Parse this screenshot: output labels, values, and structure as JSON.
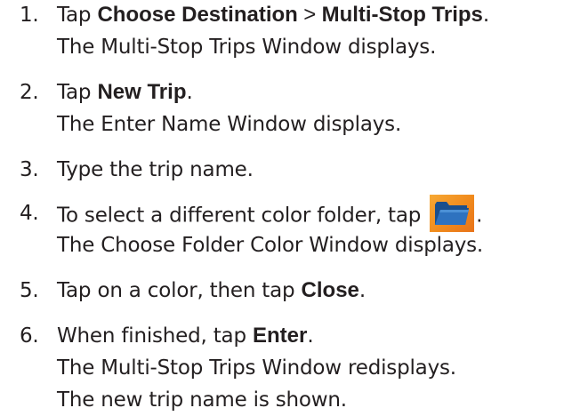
{
  "steps": [
    {
      "number": "1.",
      "line1": {
        "prefix": "Tap ",
        "bold1": "Choose Destination",
        "separator": " > ",
        "bold2": "Multi-Stop Trips",
        "suffix": "."
      },
      "line2": "The Multi-Stop Trips Window displays."
    },
    {
      "number": "2.",
      "line1": {
        "prefix": "Tap ",
        "bold": "New Trip",
        "suffix": "."
      },
      "line2": "The Enter Name Window displays."
    },
    {
      "number": "3.",
      "line1": "Type the trip name."
    },
    {
      "number": "4.",
      "line1": {
        "prefix": "To select a different color folder, tap",
        "suffix": "."
      },
      "line2": "The Choose Folder Color Window displays.",
      "icon": "blue-folder-icon"
    },
    {
      "number": "5.",
      "line1": {
        "prefix": "Tap on a color, then tap ",
        "bold": "Close",
        "suffix": "."
      }
    },
    {
      "number": "6.",
      "line1": {
        "prefix": "When finished, tap ",
        "bold": "Enter",
        "suffix": "."
      },
      "line2": "The Multi-Stop Trips Window redisplays.",
      "line3": "The new trip name is shown."
    }
  ],
  "colors": {
    "text": "#231f20",
    "folder_button_bg": "#f08a1c",
    "folder_icon": "#1e5b9e"
  }
}
